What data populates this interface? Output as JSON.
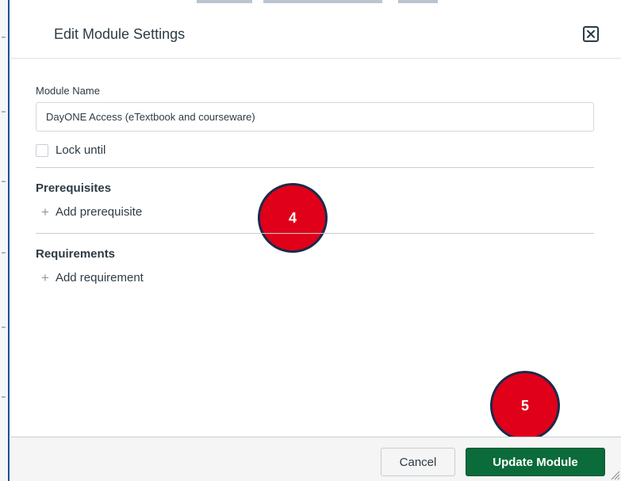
{
  "dialog": {
    "title": "Edit Module Settings",
    "close_icon": "close-icon"
  },
  "form": {
    "module_name_label": "Module Name",
    "module_name_value": "DayONE Access (eTextbook and courseware)",
    "lock_until_label": "Lock until",
    "lock_until_checked": false
  },
  "prerequisites": {
    "title": "Prerequisites",
    "add_label": "Add prerequisite",
    "add_icon": "plus-icon"
  },
  "requirements": {
    "title": "Requirements",
    "add_label": "Add requirement",
    "add_icon": "plus-icon"
  },
  "annotations": {
    "step_4": "4",
    "step_5": "5",
    "badge_color": "#e0001a"
  },
  "footer": {
    "cancel_label": "Cancel",
    "update_label": "Update Module",
    "update_color": "#0b6b3a"
  }
}
